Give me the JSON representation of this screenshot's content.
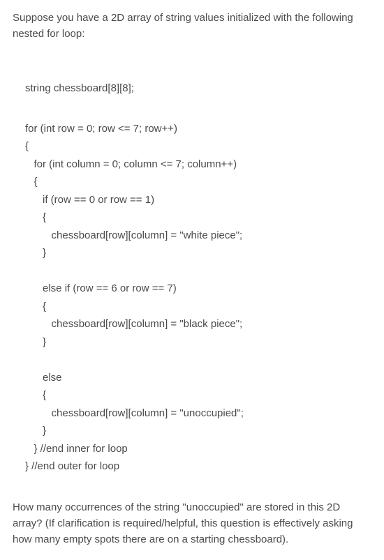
{
  "intro": "Suppose you have a 2D array of string values initialized with the following nested for loop:",
  "code": {
    "decl": "string chessboard[8][8];",
    "l1": "for (int row = 0; row <= 7; row++)",
    "l2": "{",
    "l3": "   for (int column = 0; column <= 7; column++)",
    "l4": "   {",
    "l5": "      if (row == 0 or row == 1)",
    "l6": "      {",
    "l7": "         chessboard[row][column] = \"white piece\";",
    "l8": "      }",
    "l9": "",
    "l10": "      else if (row == 6 or row == 7)",
    "l11": "      {",
    "l12": "         chessboard[row][column] = \"black piece\";",
    "l13": "      }",
    "l14": "",
    "l15": "      else",
    "l16": "      {",
    "l17": "         chessboard[row][column] = \"unoccupied\";",
    "l18": "      }",
    "l19": "   } //end inner for loop",
    "l20": "} //end outer for loop"
  },
  "question_line1": "How many occurrences of the string \"unoccupied\" are stored in this 2D array?",
  "question_line2": "(If clarification is required/helpful, this question is effectively asking how many empty spots there are on a starting chessboard)."
}
